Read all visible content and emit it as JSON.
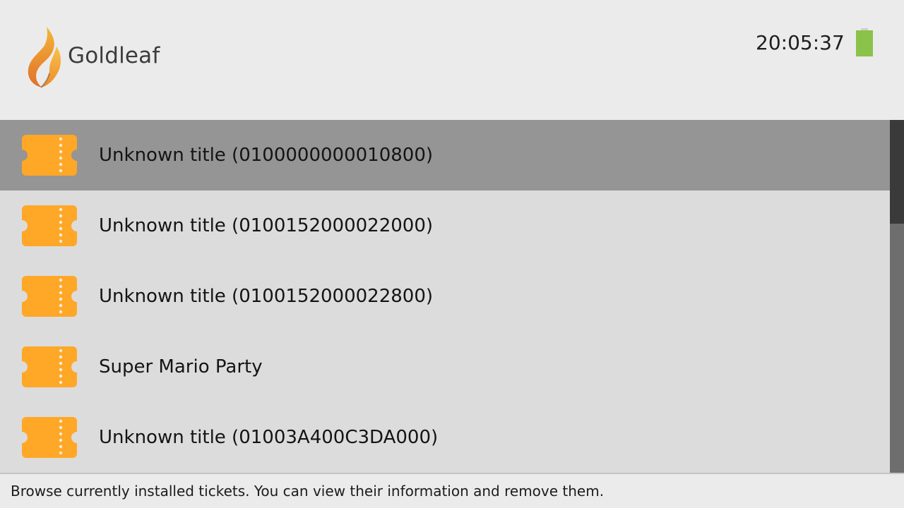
{
  "header": {
    "app_name": "Goldleaf",
    "logo_icon": "flame-logo-icon",
    "clock": "20:05:37",
    "battery_icon": "battery-icon",
    "battery_color": "#8bc34a"
  },
  "list": {
    "item_icon": "ticket-icon",
    "icon_color": "#ffa726",
    "selected_index": 0,
    "items": [
      {
        "label": "Unknown title (0100000000010800)"
      },
      {
        "label": "Unknown title (0100152000022000)"
      },
      {
        "label": "Unknown title (0100152000022800)"
      },
      {
        "label": "Super Mario Party"
      },
      {
        "label": "Unknown title (01003A400C3DA000)"
      }
    ]
  },
  "footer": {
    "hint": "Browse currently installed tickets. You can view their information and remove them."
  }
}
